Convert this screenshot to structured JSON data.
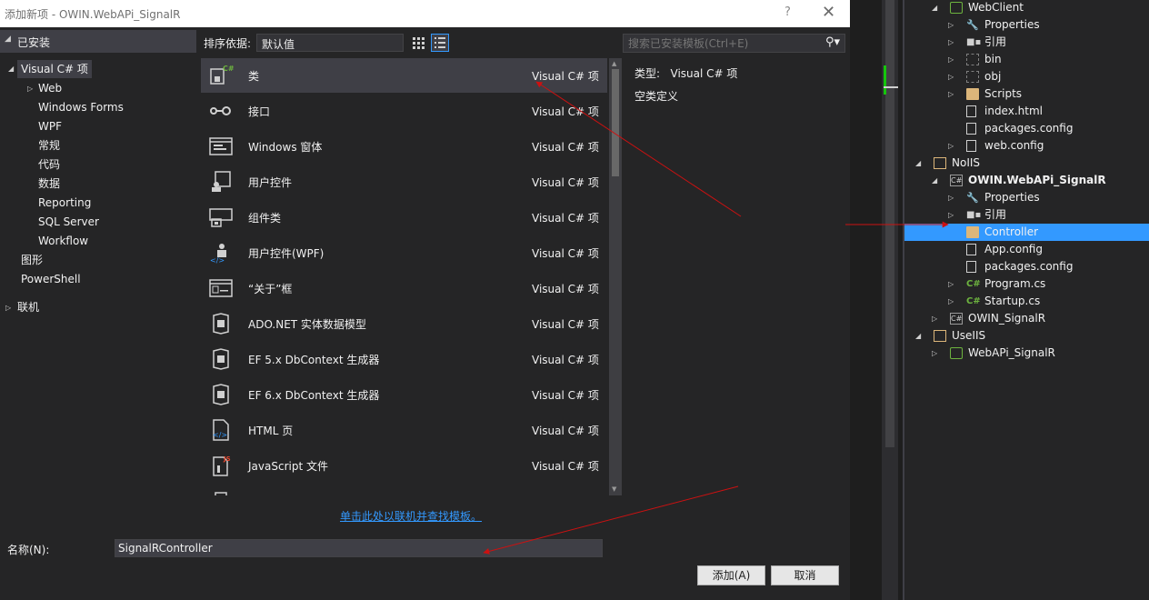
{
  "dialog": {
    "title": "添加新项 - OWIN.WebAPi_SignalR",
    "help": "?",
    "close": "✕"
  },
  "categories": {
    "installed": "已安装",
    "items": [
      {
        "label": "Visual C# 项"
      },
      {
        "label": "Web"
      },
      {
        "label": "Windows Forms"
      },
      {
        "label": "WPF"
      },
      {
        "label": "常规"
      },
      {
        "label": "代码"
      },
      {
        "label": "数据"
      },
      {
        "label": "Reporting"
      },
      {
        "label": "SQL Server"
      },
      {
        "label": "Workflow"
      },
      {
        "label": "图形"
      },
      {
        "label": "PowerShell"
      },
      {
        "label": "联机"
      }
    ]
  },
  "toolbar": {
    "sort_label": "排序依据:",
    "sort_value": "默认值",
    "search_placeholder": "搜索已安装模板(Ctrl+E)"
  },
  "templates": [
    {
      "name": "类",
      "type": "Visual C# 项",
      "icon": "class-icon"
    },
    {
      "name": "接口",
      "type": "Visual C# 项",
      "icon": "interface-icon"
    },
    {
      "name": "Windows 窗体",
      "type": "Visual C# 项",
      "icon": "windows-form-icon"
    },
    {
      "name": "用户控件",
      "type": "Visual C# 项",
      "icon": "user-control-icon"
    },
    {
      "name": "组件类",
      "type": "Visual C# 项",
      "icon": "component-class-icon"
    },
    {
      "name": "用户控件(WPF)",
      "type": "Visual C# 项",
      "icon": "wpf-user-control-icon"
    },
    {
      "name": "“关于”框",
      "type": "Visual C# 项",
      "icon": "about-box-icon"
    },
    {
      "name": "ADO.NET 实体数据模型",
      "type": "Visual C# 项",
      "icon": "ado-net-icon"
    },
    {
      "name": "EF 5.x DbContext 生成器",
      "type": "Visual C# 项",
      "icon": "ef5-icon"
    },
    {
      "name": "EF 6.x DbContext 生成器",
      "type": "Visual C# 项",
      "icon": "ef6-icon"
    },
    {
      "name": "HTML 页",
      "type": "Visual C# 项",
      "icon": "html-page-icon"
    },
    {
      "name": "JavaScript 文件",
      "type": "Visual C# 项",
      "icon": "javascript-file-icon"
    }
  ],
  "details": {
    "type_label": "类型:",
    "type_value": "Visual C# 项",
    "description": "空类定义"
  },
  "online_link": "单击此处以联机并查找模板。",
  "name_field": {
    "label": "名称(N):",
    "value": "SignalRController"
  },
  "buttons": {
    "add": "添加(A)",
    "cancel": "取消"
  },
  "solution": [
    {
      "label": "WebClient",
      "kind": "web"
    },
    {
      "label": "Properties",
      "kind": "wrench"
    },
    {
      "label": "引用",
      "kind": "ref"
    },
    {
      "label": "bin",
      "kind": "ghost"
    },
    {
      "label": "obj",
      "kind": "ghost"
    },
    {
      "label": "Scripts",
      "kind": "folder"
    },
    {
      "label": "index.html",
      "kind": "file"
    },
    {
      "label": "packages.config",
      "kind": "config"
    },
    {
      "label": "web.config",
      "kind": "config"
    },
    {
      "label": "NoIIS",
      "kind": "folder-open"
    },
    {
      "label": "OWIN.WebAPi_SignalR",
      "kind": "proj"
    },
    {
      "label": "Properties",
      "kind": "wrench"
    },
    {
      "label": "引用",
      "kind": "ref"
    },
    {
      "label": "Controller",
      "kind": "folder"
    },
    {
      "label": "App.config",
      "kind": "config"
    },
    {
      "label": "packages.config",
      "kind": "config"
    },
    {
      "label": "Program.cs",
      "kind": "cs"
    },
    {
      "label": "Startup.cs",
      "kind": "cs"
    },
    {
      "label": "OWIN_SignalR",
      "kind": "proj"
    },
    {
      "label": "UseIIS",
      "kind": "folder-open"
    },
    {
      "label": "WebAPi_SignalR",
      "kind": "web"
    }
  ],
  "colors": {
    "accent": "#3399ff",
    "annotation_arrow": "#cc1111"
  }
}
